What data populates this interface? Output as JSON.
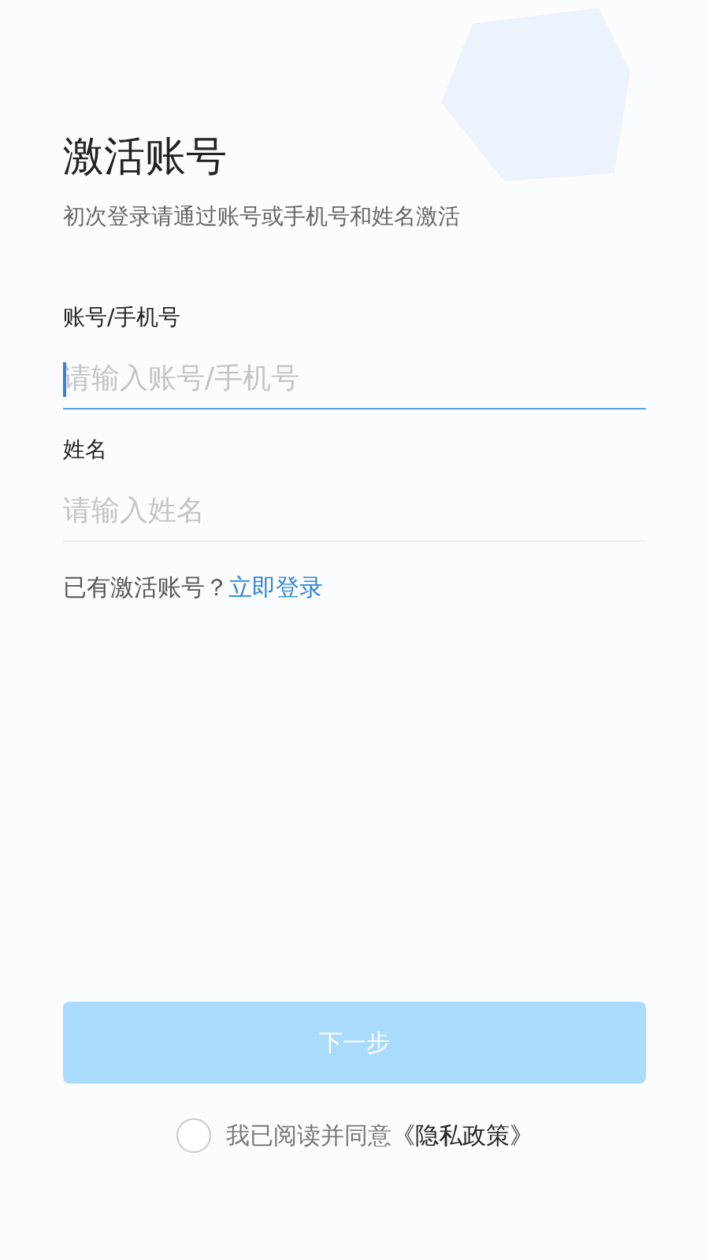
{
  "title": "激活账号",
  "subtitle": "初次登录请通过账号或手机号和姓名激活",
  "fields": [
    {
      "label": "账号/手机号",
      "placeholder": "请输入账号/手机号",
      "focused": true
    },
    {
      "label": "姓名",
      "placeholder": "请输入姓名",
      "focused": false
    }
  ],
  "login_prompt": {
    "text": "已有激活账号？",
    "link": "立即登录"
  },
  "next_button": {
    "label": "下一步",
    "disabled": true
  },
  "agreement": {
    "checked": false,
    "text": "我已阅读并同意",
    "link": "《隐私政策》"
  }
}
